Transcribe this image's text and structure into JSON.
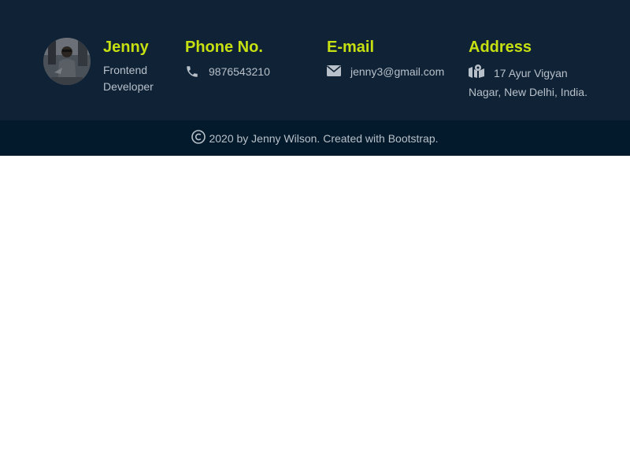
{
  "profile": {
    "name": "Jenny",
    "role_line1": "Frontend",
    "role_line2": "Developer"
  },
  "phone": {
    "title": "Phone No.",
    "value": "9876543210",
    "icon": "phone-icon"
  },
  "email": {
    "title": "E-mail",
    "value": "jenny3@gmail.com",
    "icon": "envelope-icon"
  },
  "address": {
    "title": "Address",
    "line1": "17 Ayur Vigyan",
    "line2": "Nagar, New Delhi, India.",
    "icon": "map-icon"
  },
  "copyright": {
    "icon": "copyright-icon",
    "text": "2020 by Jenny Wilson. Created with Bootstrap."
  },
  "colors": {
    "footer_bg": "#0f2236",
    "bottom_bar_bg": "#031a2c",
    "accent": "#c6e011",
    "text": "#b8c0c9"
  }
}
